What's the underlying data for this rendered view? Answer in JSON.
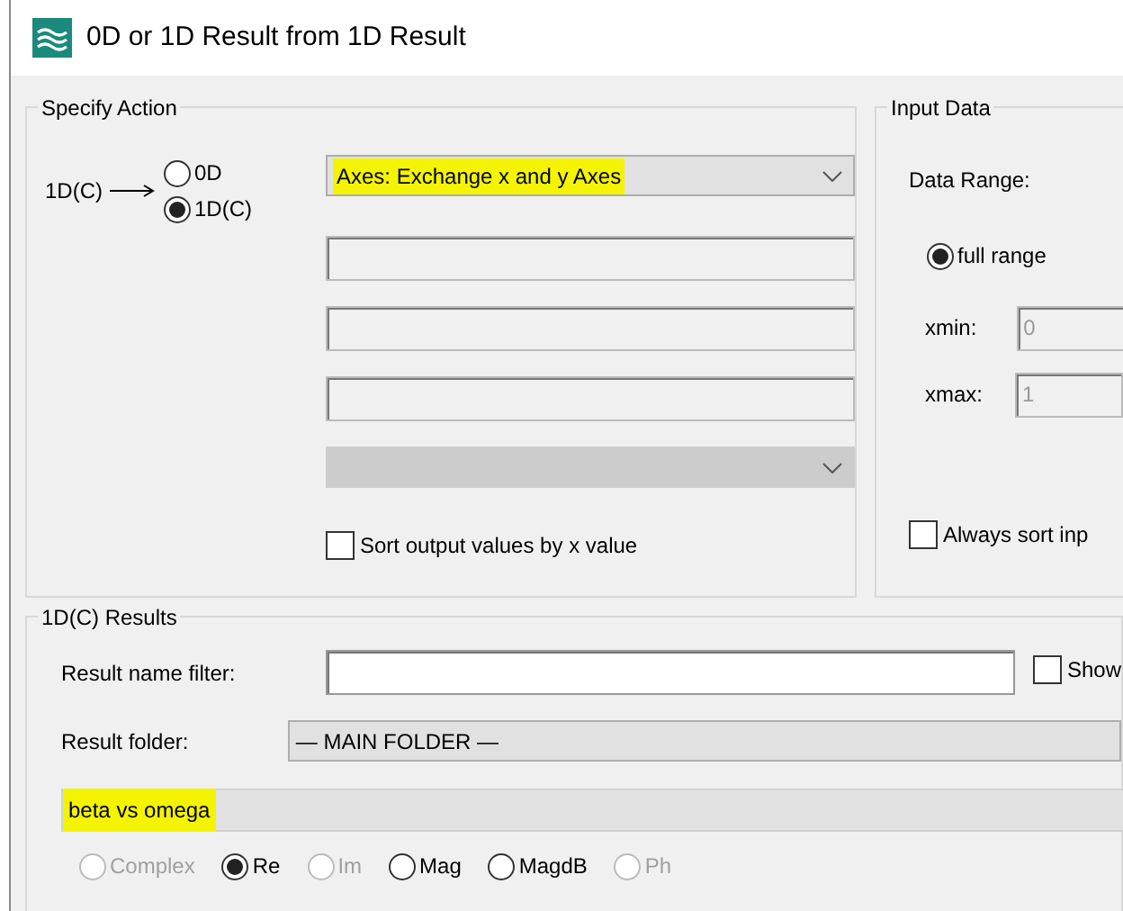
{
  "window": {
    "title": "0D or 1D Result from 1D Result"
  },
  "specify_action": {
    "title": "Specify Action",
    "source_label": "1D(C)",
    "targets": [
      {
        "label": "0D",
        "selected": false
      },
      {
        "label": "1D(C)",
        "selected": true
      }
    ],
    "action": {
      "value": "Axes: Exchange x and y Axes",
      "highlighted": true
    },
    "param_fields": [
      {
        "kind": "text",
        "disabled": false
      },
      {
        "kind": "text",
        "disabled": false
      },
      {
        "kind": "text",
        "disabled": false
      },
      {
        "kind": "dropdown",
        "disabled": true
      }
    ],
    "sort_checkbox": {
      "label": "Sort output values by x value",
      "checked": false
    }
  },
  "input_data": {
    "title": "Input Data",
    "data_range_label": "Data Range:",
    "range_options": [
      {
        "label": "full range",
        "selected": true
      }
    ],
    "xmin": {
      "label": "xmin:",
      "value": "0",
      "disabled": true
    },
    "xmax": {
      "label": "xmax:",
      "value": "1",
      "disabled": true
    },
    "always_sort": {
      "label": "Always sort inp",
      "checked": false
    }
  },
  "results": {
    "title": "1D(C) Results",
    "name_filter": {
      "label": "Result name filter:"
    },
    "show_checkbox": {
      "label": "Show",
      "checked": false
    },
    "folder": {
      "label": "Result folder:",
      "value": "— MAIN FOLDER —"
    },
    "list": [
      {
        "label": "beta vs omega",
        "highlighted": true
      }
    ],
    "components": [
      {
        "label": "Complex",
        "selected": false,
        "disabled": true
      },
      {
        "label": "Re",
        "selected": true,
        "disabled": false
      },
      {
        "label": "Im",
        "selected": false,
        "disabled": true
      },
      {
        "label": "Mag",
        "selected": false,
        "disabled": false
      },
      {
        "label": "MagdB",
        "selected": false,
        "disabled": false
      },
      {
        "label": "Ph",
        "selected": false,
        "disabled": true
      }
    ]
  }
}
